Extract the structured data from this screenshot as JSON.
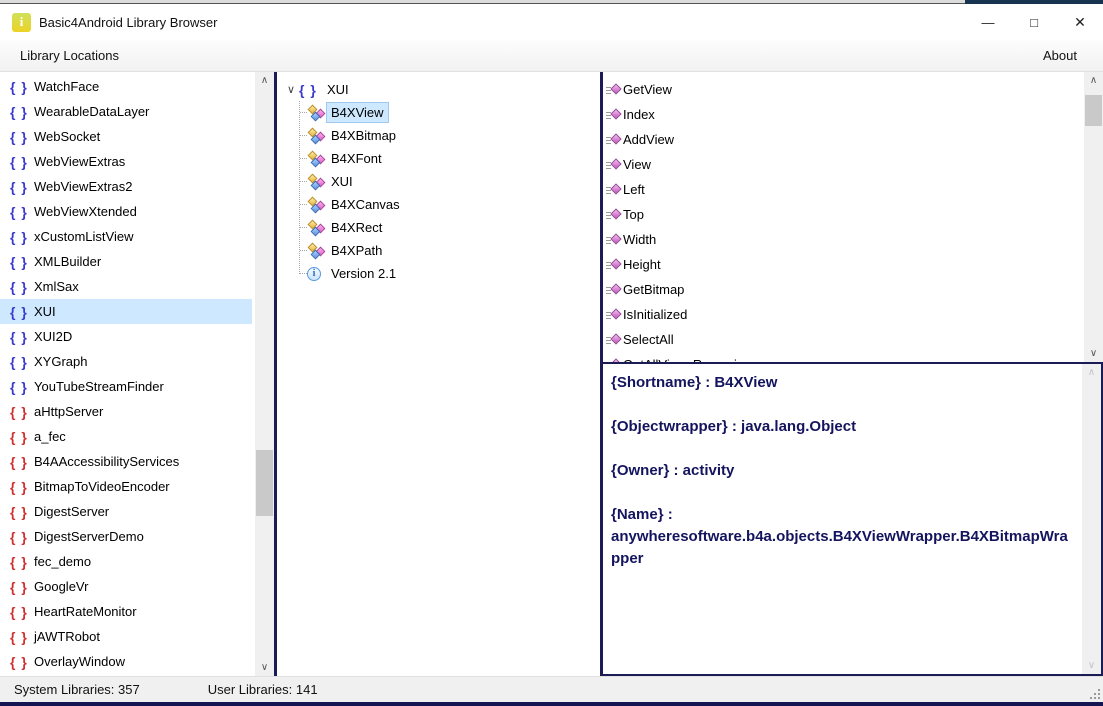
{
  "window": {
    "title": "Basic4Android Library Browser"
  },
  "icons": {
    "minimize": "—",
    "maximize": "□",
    "close": "✕",
    "braces": "{ }",
    "chevron_expanded": "∨",
    "scroll_up": "∧",
    "scroll_down": "∨",
    "info": "i",
    "app_badge": "i"
  },
  "menu": {
    "library_locations": "Library Locations",
    "about": "About"
  },
  "library_list": {
    "selected": "XUI",
    "items": [
      {
        "label": "WatchFace",
        "color": "blue"
      },
      {
        "label": "WearableDataLayer",
        "color": "blue"
      },
      {
        "label": "WebSocket",
        "color": "blue"
      },
      {
        "label": "WebViewExtras",
        "color": "blue"
      },
      {
        "label": "WebViewExtras2",
        "color": "blue"
      },
      {
        "label": "WebViewXtended",
        "color": "blue"
      },
      {
        "label": "xCustomListView",
        "color": "blue"
      },
      {
        "label": "XMLBuilder",
        "color": "blue"
      },
      {
        "label": "XmlSax",
        "color": "blue"
      },
      {
        "label": "XUI",
        "color": "blue"
      },
      {
        "label": "XUI2D",
        "color": "blue"
      },
      {
        "label": "XYGraph",
        "color": "blue"
      },
      {
        "label": "YouTubeStreamFinder",
        "color": "blue"
      },
      {
        "label": "aHttpServer",
        "color": "red"
      },
      {
        "label": "a_fec",
        "color": "red"
      },
      {
        "label": "B4AAccessibilityServices",
        "color": "red"
      },
      {
        "label": "BitmapToVideoEncoder",
        "color": "red"
      },
      {
        "label": "DigestServer",
        "color": "red"
      },
      {
        "label": "DigestServerDemo",
        "color": "red"
      },
      {
        "label": "fec_demo",
        "color": "red"
      },
      {
        "label": "GoogleVr",
        "color": "red"
      },
      {
        "label": "HeartRateMonitor",
        "color": "red"
      },
      {
        "label": "jAWTRobot",
        "color": "red"
      },
      {
        "label": "OverlayWindow",
        "color": "red"
      }
    ]
  },
  "tree": {
    "root": "XUI",
    "selected": "B4XView",
    "classes": [
      "B4XView",
      "B4XBitmap",
      "B4XFont",
      "XUI",
      "B4XCanvas",
      "B4XRect",
      "B4XPath"
    ],
    "version": "Version 2.1"
  },
  "members": {
    "items": [
      "GetView",
      "Index",
      "AddView",
      "View",
      "Left",
      "Top",
      "Width",
      "Height",
      "GetBitmap",
      "IsInitialized",
      "SelectAll",
      "GetAllViewsRecursive"
    ]
  },
  "details": {
    "lines": [
      "{Shortname} : B4XView",
      "",
      "{Objectwrapper} : java.lang.Object",
      "",
      "{Owner} : activity",
      "",
      "{Name} :",
      "anywheresoftware.b4a.objects.B4XViewWrapper.B4XBitmapWrapper"
    ]
  },
  "status_bar": {
    "system": "System Libraries: 357",
    "user": "User Libraries: 141"
  },
  "colors": {
    "selection": "#cde8ff",
    "navy_border": "#1b1b55",
    "details_text": "#14145e",
    "blue_brace": "#3a3ace",
    "red_brace": "#cf3030"
  }
}
